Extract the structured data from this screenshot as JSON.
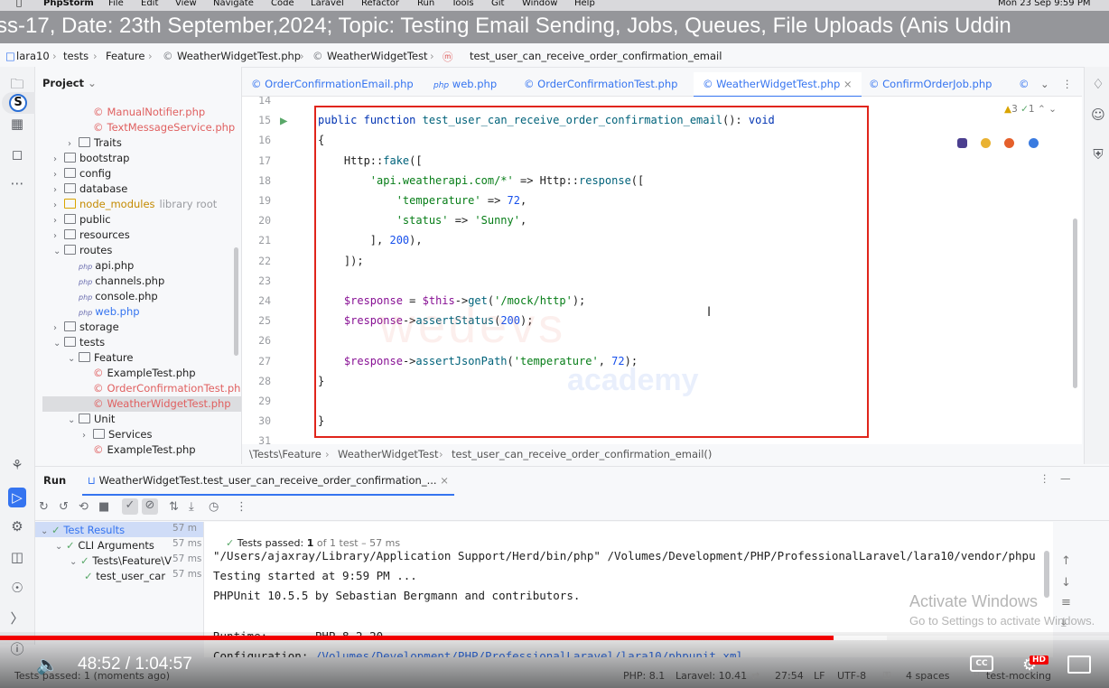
{
  "menubar": {
    "app": "PhpStorm",
    "items": [
      "File",
      "Edit",
      "View",
      "Navigate",
      "Code",
      "Laravel",
      "Refactor",
      "Run",
      "Tools",
      "Git",
      "Window",
      "Help"
    ],
    "clock": "Mon 23 Sep  9:59 PM"
  },
  "video_title": "ss-17, Date: 23th September,2024; Topic: Testing Email Sending, Jobs, Queues, File Uploads (Anis Uddin",
  "breadcrumb": [
    "lara10",
    "tests",
    "Feature",
    "WeatherWidgetTest.php",
    "WeatherWidgetTest",
    "test_user_can_receive_order_confirmation_email"
  ],
  "project": {
    "header": "Project",
    "items": [
      {
        "label": "ManualNotifier.php",
        "kind": "file",
        "level": 4
      },
      {
        "label": "TextMessageService.php",
        "kind": "file",
        "level": 4
      },
      {
        "label": "Traits",
        "kind": "folder",
        "level": 3
      },
      {
        "label": "bootstrap",
        "kind": "folder",
        "level": 2
      },
      {
        "label": "config",
        "kind": "folder",
        "level": 2
      },
      {
        "label": "database",
        "kind": "folder",
        "level": 2
      },
      {
        "label": "node_modules",
        "kind": "folder",
        "level": 2,
        "suffix": "library root"
      },
      {
        "label": "public",
        "kind": "folder",
        "level": 2
      },
      {
        "label": "resources",
        "kind": "folder",
        "level": 2
      },
      {
        "label": "routes",
        "kind": "folder",
        "level": 2,
        "open": true
      },
      {
        "label": "api.php",
        "kind": "php",
        "level": 3
      },
      {
        "label": "channels.php",
        "kind": "php",
        "level": 3
      },
      {
        "label": "console.php",
        "kind": "php",
        "level": 3
      },
      {
        "label": "web.php",
        "kind": "php",
        "level": 3
      },
      {
        "label": "storage",
        "kind": "folder",
        "level": 2
      },
      {
        "label": "tests",
        "kind": "folder",
        "level": 2,
        "open": true
      },
      {
        "label": "Feature",
        "kind": "folder",
        "level": 3,
        "open": true
      },
      {
        "label": "ExampleTest.php",
        "kind": "file",
        "level": 4
      },
      {
        "label": "OrderConfirmationTest.php",
        "kind": "file",
        "level": 4
      },
      {
        "label": "WeatherWidgetTest.php",
        "kind": "file",
        "level": 4,
        "selected": true
      },
      {
        "label": "Unit",
        "kind": "folder",
        "level": 3,
        "open": true
      },
      {
        "label": "Services",
        "kind": "folder",
        "level": 4
      },
      {
        "label": "ExampleTest.php",
        "kind": "file",
        "level": 4
      }
    ]
  },
  "tabs": [
    "OrderConfirmationEmail.php",
    "web.php",
    "OrderConfirmationTest.php",
    "WeatherWidgetTest.php",
    "ConfirmOrderJob.php"
  ],
  "active_tab": "WeatherWidgetTest.php",
  "editor": {
    "inspection": "3",
    "inspection2": "1",
    "lines": [
      {
        "n": "14",
        "t": ""
      },
      {
        "n": "15",
        "t": "public function test_user_can_receive_order_confirmation_email(): void"
      },
      {
        "n": "16",
        "t": "{"
      },
      {
        "n": "17",
        "t": "    Http::fake(["
      },
      {
        "n": "18",
        "t": "        'api.weatherapi.com/*' => Http::response(["
      },
      {
        "n": "19",
        "t": "            'temperature' => 72,"
      },
      {
        "n": "20",
        "t": "            'status' => 'Sunny',"
      },
      {
        "n": "21",
        "t": "        ], 200),"
      },
      {
        "n": "22",
        "t": "    ]);"
      },
      {
        "n": "23",
        "t": ""
      },
      {
        "n": "24",
        "t": "    $response = $this->get('/mock/http');"
      },
      {
        "n": "25",
        "t": "    $response->assertStatus(200);"
      },
      {
        "n": "26",
        "t": ""
      },
      {
        "n": "27",
        "t": "    $response->assertJsonPath('temperature', 72);"
      },
      {
        "n": "28",
        "t": "}"
      },
      {
        "n": "29",
        "t": ""
      },
      {
        "n": "30",
        "t": "}"
      },
      {
        "n": "31",
        "t": ""
      }
    ],
    "crumb": [
      "\\Tests\\Feature",
      "WeatherWidgetTest",
      "test_user_can_receive_order_confirmation_email()"
    ],
    "watermark": "wedevs",
    "watermark2": "academy"
  },
  "run": {
    "label": "Run",
    "tab": "WeatherWidgetTest.test_user_can_receive_order_confirmation_...",
    "passed_label": "Tests passed:",
    "passed_value": "1",
    "passed_rest": "of 1 test – 57 ms",
    "results": [
      {
        "label": "Test Results",
        "ms": "57 m",
        "level": 0,
        "selected": true
      },
      {
        "label": "CLI Arguments",
        "ms": "57 ms",
        "level": 1
      },
      {
        "label": "Tests\\Feature\\V",
        "ms": "57 ms",
        "level": 2
      },
      {
        "label": "test_user_car",
        "ms": "57 ms",
        "level": 3
      }
    ],
    "console": [
      "\"/Users/ajaxray/Library/Application Support/Herd/bin/php\" /Volumes/Development/PHP/ProfessionalLaravel/lara10/vendor/phpu",
      "Testing started at 9:59 PM ...",
      "PHPUnit 10.5.5 by Sebastian Bergmann and contributors.",
      "",
      "Runtime:       PHP 8.2.20",
      "Configuration: /Volumes/Development/PHP/ProfessionalLaravel/lara10/phpunit.xml"
    ]
  },
  "activate": {
    "line1": "Activate Windows",
    "line2": "Go to Settings to activate Windows."
  },
  "player": {
    "time": "48:52 / 1:04:57",
    "progress": 0.752,
    "buffered": 0.8,
    "hd": "HD"
  },
  "status": {
    "left": "Tests passed: 1 (moments ago)",
    "items": [
      "PHP: 8.1",
      "Laravel: 10.41",
      "27:54",
      "LF",
      "UTF-8",
      "4 spaces",
      "test-mocking"
    ]
  },
  "colors": {
    "accent": "#3574f0",
    "red": "#e0251b",
    "progress": "#f20000"
  }
}
